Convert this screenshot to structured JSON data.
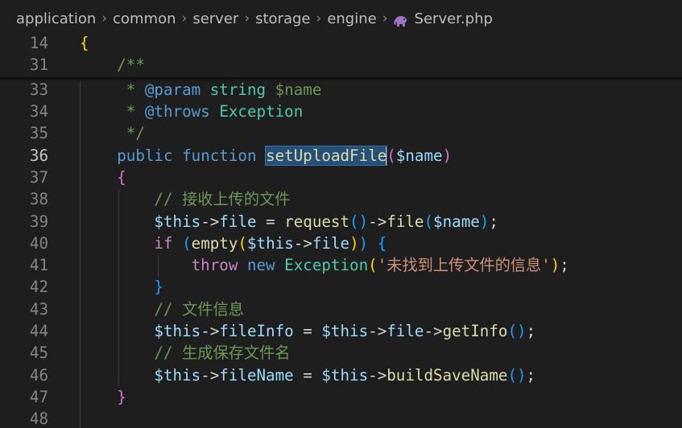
{
  "breadcrumb": {
    "segments": [
      "application",
      "common",
      "server",
      "storage",
      "engine"
    ],
    "file_icon": "php-elephant-icon",
    "file_name": "Server.php"
  },
  "colors": {
    "background": "#1e1e1e",
    "selection": "#264f78",
    "comment": "#6a9955",
    "keyword": "#569cd6",
    "function": "#dcdcaa",
    "string": "#ce9178",
    "variable": "#9cdcfe"
  },
  "active_line": "36",
  "lines": [
    {
      "n": "14",
      "t": [
        [
          "t-brace0",
          "{"
        ]
      ]
    },
    {
      "n": "31",
      "t": [
        [
          "t-plain",
          "    "
        ],
        [
          "t-comment",
          "/**"
        ]
      ]
    },
    {
      "n": "33",
      "t": [
        [
          "t-plain",
          "     "
        ],
        [
          "t-comment",
          "* "
        ],
        [
          "t-doctag",
          "@param"
        ],
        [
          "t-plain",
          " "
        ],
        [
          "t-type",
          "string"
        ],
        [
          "t-plain",
          " "
        ],
        [
          "t-comment",
          "$name"
        ]
      ]
    },
    {
      "n": "34",
      "t": [
        [
          "t-plain",
          "     "
        ],
        [
          "t-comment",
          "* "
        ],
        [
          "t-doctag",
          "@throws"
        ],
        [
          "t-plain",
          " "
        ],
        [
          "t-type",
          "Exception"
        ]
      ]
    },
    {
      "n": "35",
      "t": [
        [
          "t-plain",
          "     "
        ],
        [
          "t-comment",
          "*/"
        ]
      ]
    },
    {
      "n": "36",
      "t": [
        [
          "t-plain",
          "    "
        ],
        [
          "t-kw",
          "public"
        ],
        [
          "t-plain",
          " "
        ],
        [
          "t-kw",
          "function"
        ],
        [
          "t-plain",
          " "
        ],
        [
          "t-sel",
          "setUploadFile"
        ],
        [
          "caret",
          ""
        ],
        [
          "t-brace1",
          "("
        ],
        [
          "t-var",
          "$name"
        ],
        [
          "t-brace1",
          ")"
        ]
      ]
    },
    {
      "n": "37",
      "t": [
        [
          "t-plain",
          "    "
        ],
        [
          "t-brace1",
          "{"
        ]
      ]
    },
    {
      "n": "38",
      "t": [
        [
          "t-plain",
          "        "
        ],
        [
          "t-comment",
          "// 接收上传的文件"
        ]
      ]
    },
    {
      "n": "39",
      "t": [
        [
          "t-plain",
          "        "
        ],
        [
          "t-var",
          "$this"
        ],
        [
          "t-plain",
          "->"
        ],
        [
          "t-var",
          "file"
        ],
        [
          "t-plain",
          " = "
        ],
        [
          "t-fn",
          "request"
        ],
        [
          "t-brace2",
          "()"
        ],
        [
          "t-plain",
          "->"
        ],
        [
          "t-fn",
          "file"
        ],
        [
          "t-brace2",
          "("
        ],
        [
          "t-var",
          "$name"
        ],
        [
          "t-brace2",
          ")"
        ],
        [
          "t-plain",
          ";"
        ]
      ]
    },
    {
      "n": "40",
      "t": [
        [
          "t-plain",
          "        "
        ],
        [
          "t-ctl",
          "if"
        ],
        [
          "t-plain",
          " "
        ],
        [
          "t-brace2",
          "("
        ],
        [
          "t-fn",
          "empty"
        ],
        [
          "t-brace0",
          "("
        ],
        [
          "t-var",
          "$this"
        ],
        [
          "t-plain",
          "->"
        ],
        [
          "t-var",
          "file"
        ],
        [
          "t-brace0",
          ")"
        ],
        [
          "t-brace2",
          ")"
        ],
        [
          "t-plain",
          " "
        ],
        [
          "t-brace2",
          "{"
        ]
      ]
    },
    {
      "n": "41",
      "t": [
        [
          "t-plain",
          "            "
        ],
        [
          "t-ctl",
          "throw"
        ],
        [
          "t-plain",
          " "
        ],
        [
          "t-kw",
          "new"
        ],
        [
          "t-plain",
          " "
        ],
        [
          "t-cls",
          "Exception"
        ],
        [
          "t-brace0",
          "("
        ],
        [
          "t-str",
          "'未找到上传文件的信息'"
        ],
        [
          "t-brace0",
          ")"
        ],
        [
          "t-plain",
          ";"
        ]
      ]
    },
    {
      "n": "42",
      "t": [
        [
          "t-plain",
          "        "
        ],
        [
          "t-brace2",
          "}"
        ]
      ]
    },
    {
      "n": "43",
      "t": [
        [
          "t-plain",
          "        "
        ],
        [
          "t-comment",
          "// 文件信息"
        ]
      ]
    },
    {
      "n": "44",
      "t": [
        [
          "t-plain",
          "        "
        ],
        [
          "t-var",
          "$this"
        ],
        [
          "t-plain",
          "->"
        ],
        [
          "t-var",
          "fileInfo"
        ],
        [
          "t-plain",
          " = "
        ],
        [
          "t-var",
          "$this"
        ],
        [
          "t-plain",
          "->"
        ],
        [
          "t-var",
          "file"
        ],
        [
          "t-plain",
          "->"
        ],
        [
          "t-fn",
          "getInfo"
        ],
        [
          "t-brace2",
          "()"
        ],
        [
          "t-plain",
          ";"
        ]
      ]
    },
    {
      "n": "45",
      "t": [
        [
          "t-plain",
          "        "
        ],
        [
          "t-comment",
          "// 生成保存文件名"
        ]
      ]
    },
    {
      "n": "46",
      "t": [
        [
          "t-plain",
          "        "
        ],
        [
          "t-var",
          "$this"
        ],
        [
          "t-plain",
          "->"
        ],
        [
          "t-var",
          "fileName"
        ],
        [
          "t-plain",
          " = "
        ],
        [
          "t-var",
          "$this"
        ],
        [
          "t-plain",
          "->"
        ],
        [
          "t-fn",
          "buildSaveName"
        ],
        [
          "t-brace2",
          "()"
        ],
        [
          "t-plain",
          ";"
        ]
      ]
    },
    {
      "n": "47",
      "t": [
        [
          "t-plain",
          "    "
        ],
        [
          "t-brace1",
          "}"
        ]
      ]
    },
    {
      "n": "48",
      "t": []
    }
  ]
}
